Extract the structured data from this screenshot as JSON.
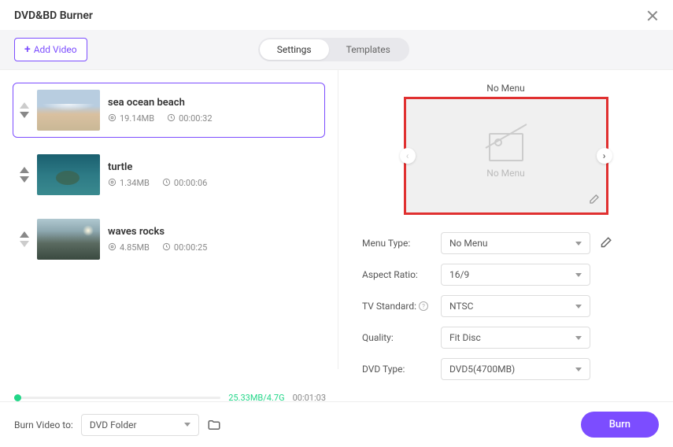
{
  "window": {
    "title": "DVD&BD Burner"
  },
  "toolbar": {
    "add_label": "Add Video"
  },
  "tabs": {
    "settings": "Settings",
    "templates": "Templates"
  },
  "videos": [
    {
      "name": "sea ocean beach",
      "size": "19.14MB",
      "duration": "00:00:32"
    },
    {
      "name": "turtle",
      "size": "1.34MB",
      "duration": "00:00:06"
    },
    {
      "name": "waves rocks",
      "size": "4.85MB",
      "duration": "00:00:25"
    }
  ],
  "preview": {
    "title": "No Menu",
    "placeholder": "No Menu"
  },
  "form": {
    "menu_type": {
      "label": "Menu Type:",
      "value": "No Menu"
    },
    "aspect": {
      "label": "Aspect Ratio:",
      "value": "16/9"
    },
    "tv": {
      "label": "TV Standard:",
      "value": "NTSC"
    },
    "quality": {
      "label": "Quality:",
      "value": "Fit Disc"
    },
    "dvd": {
      "label": "DVD Type:",
      "value": "DVD5(4700MB)"
    }
  },
  "progress": {
    "ratio": "25.33MB/4.7G",
    "time": "00:01:03"
  },
  "footer": {
    "label": "Burn Video to:",
    "destination": "DVD Folder",
    "burn": "Burn"
  }
}
